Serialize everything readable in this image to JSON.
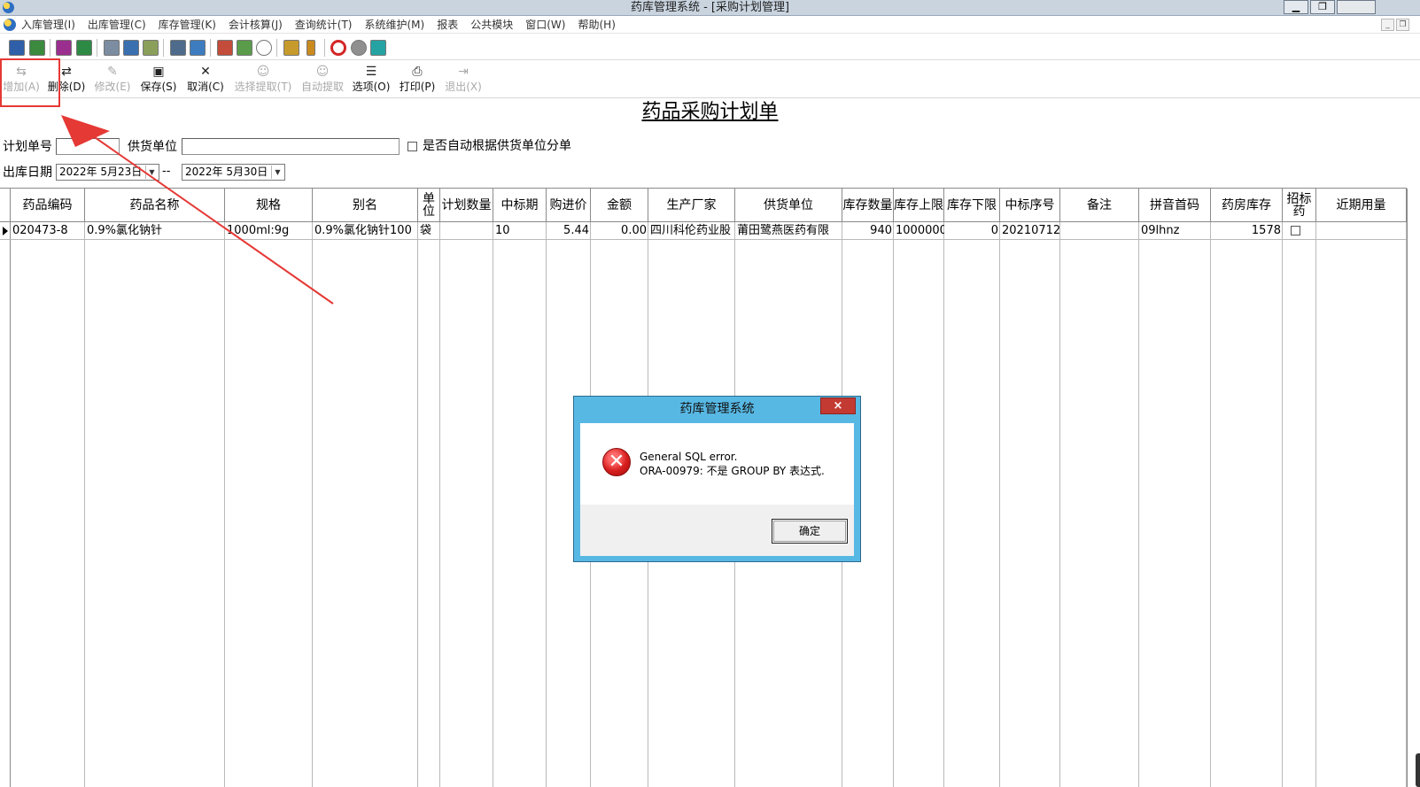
{
  "window": {
    "title": "药库管理系统 - [采购计划管理]"
  },
  "menu": [
    "入库管理(I)",
    "出库管理(C)",
    "库存管理(K)",
    "会计核算(J)",
    "查询统计(T)",
    "系统维护(M)",
    "报表",
    "公共模块",
    "窗口(W)",
    "帮助(H)"
  ],
  "toolbar": {
    "buttons": [
      {
        "name": "add-button",
        "icon": "add-icon",
        "glyph": "⇆",
        "label": "增加(A)",
        "enabled": false
      },
      {
        "name": "delete-button",
        "icon": "delete-icon",
        "glyph": "⇄",
        "label": "删除(D)",
        "enabled": true
      },
      {
        "name": "edit-button",
        "icon": "edit-icon",
        "glyph": "✎",
        "label": "修改(E)",
        "enabled": false
      },
      {
        "name": "save-button",
        "icon": "save-icon",
        "glyph": "▣",
        "label": "保存(S)",
        "enabled": true
      },
      {
        "name": "cancel-button",
        "icon": "cancel-icon",
        "glyph": "✕",
        "label": "取消(C)",
        "enabled": true
      },
      {
        "name": "select-extract-button",
        "icon": "user-icon",
        "glyph": "☺",
        "label": "选择提取(T)",
        "enabled": false
      },
      {
        "name": "auto-extract-button",
        "icon": "user-icon",
        "glyph": "☺",
        "label": "自动提取",
        "enabled": false
      },
      {
        "name": "options-button",
        "icon": "options-icon",
        "glyph": "☰",
        "label": "选项(O)",
        "enabled": true
      },
      {
        "name": "print-button",
        "icon": "printer-icon",
        "glyph": "⎙",
        "label": "打印(P)",
        "enabled": true
      },
      {
        "name": "exit-button",
        "icon": "exit-icon",
        "glyph": "⇥",
        "label": "退出(X)",
        "enabled": false
      }
    ]
  },
  "form": {
    "title": "药品采购计划单",
    "plan_no_label": "计划单号",
    "plan_no_value": "",
    "supplier_label": "供货单位",
    "supplier_value": "",
    "auto_split_label": "是否自动根据供货单位分单",
    "auto_split_checked": false,
    "date_label": "出库日期",
    "date_from": "2022年 5月23日",
    "date_sep": "--",
    "date_to": "2022年 5月30日"
  },
  "grid": {
    "columns": [
      "药品编码",
      "药品名称",
      "规格",
      "别名",
      "单位",
      "计划数量",
      "中标期",
      "购进价",
      "金额",
      "生产厂家",
      "供货单位",
      "库存数量",
      "库存上限",
      "库存下限",
      "中标序号",
      "备注",
      "拼音首码",
      "药房库存",
      "招标药",
      "近期用量"
    ],
    "rows": [
      {
        "cells": [
          "020473-8",
          "0.9%氯化钠针",
          "1000ml:9g",
          "0.9%氯化钠针100",
          "袋",
          "",
          "10",
          "5.44",
          "0.00",
          "四川科伦药业股",
          "莆田鹭燕医药有限",
          "940",
          "1000000",
          "0",
          "20210712",
          "",
          "09lhnz",
          "1578",
          "",
          ""
        ],
        "tender_checked": false
      }
    ]
  },
  "dialog": {
    "title": "药库管理系统",
    "close": "×",
    "icon": "error-icon",
    "message_line1": "General SQL error.",
    "message_line2": "ORA-00979: 不是 GROUP BY 表达式.",
    "ok_label": "确定"
  },
  "colors": {
    "dialog_frame": "#58b8e4",
    "close_button": "#c33a32",
    "highlight": "#e53935"
  }
}
